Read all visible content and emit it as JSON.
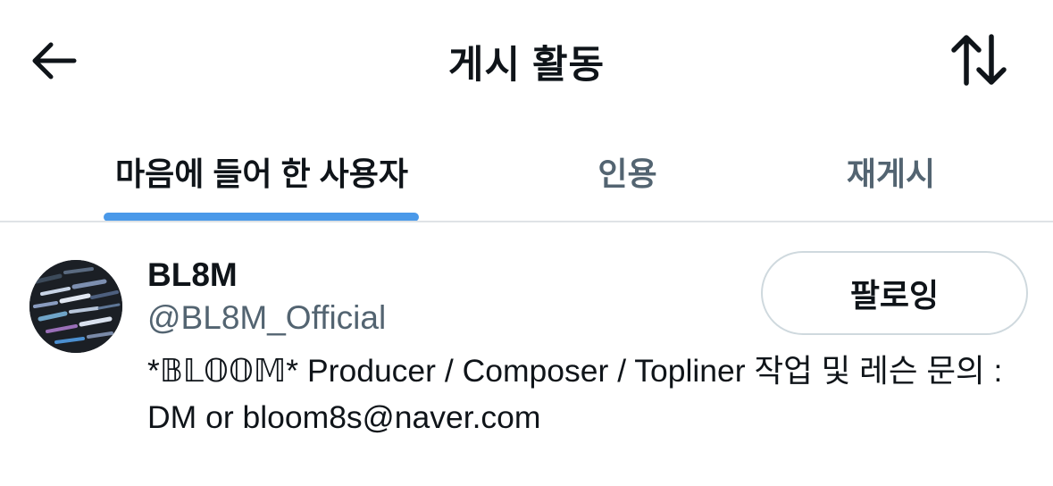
{
  "header": {
    "title": "게시 활동",
    "back_icon": "arrow-left-icon",
    "sort_icon": "sort-arrows-icon"
  },
  "tabs": [
    {
      "label": "마음에 들어 한 사용자",
      "active": true
    },
    {
      "label": "인용",
      "active": false
    },
    {
      "label": "재게시",
      "active": false
    }
  ],
  "colors": {
    "accent": "#4a99e9",
    "text_primary": "#0f1419",
    "text_secondary": "#536471",
    "border": "#cfd9de"
  },
  "user": {
    "display_name": "BL8M",
    "handle": "@BL8M_Official",
    "follow_label": "팔로잉",
    "bio": "*𝔹𝕃𝕆𝕆𝕄* Producer / Composer / Topliner 작업 및 레슨 문의 : DM or bloom8s@naver.com"
  }
}
